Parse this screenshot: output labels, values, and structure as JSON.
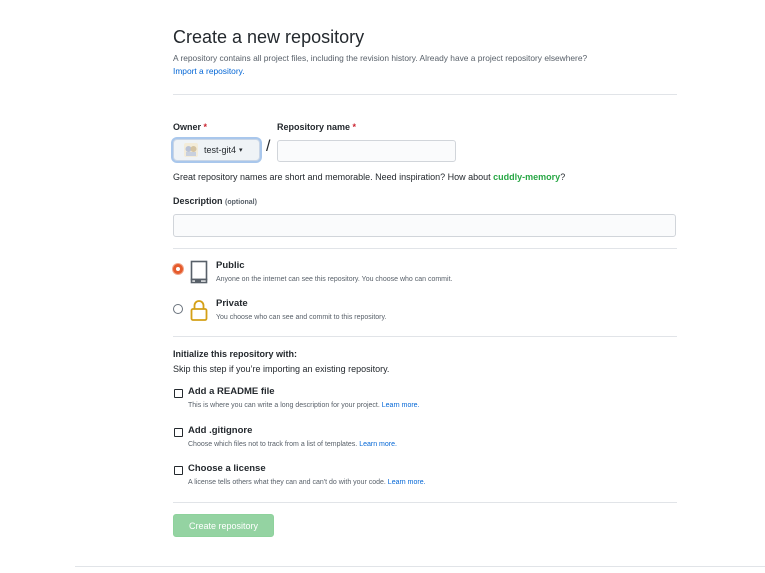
{
  "page": {
    "title": "Create a new repository",
    "intro_text": "A repository contains all project files, including the revision history. Already have a project repository elsewhere?",
    "import_link": "Import a repository."
  },
  "owner": {
    "label": "Owner",
    "required_mark": "*",
    "value": "test-git4",
    "caret": "▾"
  },
  "repo": {
    "separator": "/",
    "label": "Repository name",
    "required_mark": "*",
    "value": ""
  },
  "suggestion": {
    "prefix": "Great repository names are short and memorable. Need inspiration? How about ",
    "name": "cuddly-memory",
    "suffix": "?"
  },
  "description": {
    "label": "Description",
    "optional": "(optional)",
    "value": ""
  },
  "visibility": {
    "selected": "public",
    "public": {
      "title": "Public",
      "desc": "Anyone on the internet can see this repository. You choose who can commit."
    },
    "private": {
      "title": "Private",
      "desc": "You choose who can see and commit to this repository."
    }
  },
  "init": {
    "title": "Initialize this repository with:",
    "subtitle": "Skip this step if you’re importing an existing repository.",
    "options": [
      {
        "title": "Add a README file",
        "desc": "This is where you can write a long description for your project.",
        "link": "Learn more.",
        "checked": false
      },
      {
        "title": "Add .gitignore",
        "desc": "Choose which files not to track from a list of templates.",
        "link": "Learn more.",
        "checked": false
      },
      {
        "title": "Choose a license",
        "desc": "A license tells others what they can and can't do with your code.",
        "link": "Learn more.",
        "checked": false
      }
    ]
  },
  "submit": {
    "label": "Create repository",
    "disabled": true
  },
  "colors": {
    "accent_link": "#0366d6",
    "success_green": "#28a745",
    "radio_selected": "#e55b2d",
    "button_disabled": "#94d3a2"
  },
  "icons": {
    "public": "repo-book-icon",
    "private": "lock-icon"
  }
}
